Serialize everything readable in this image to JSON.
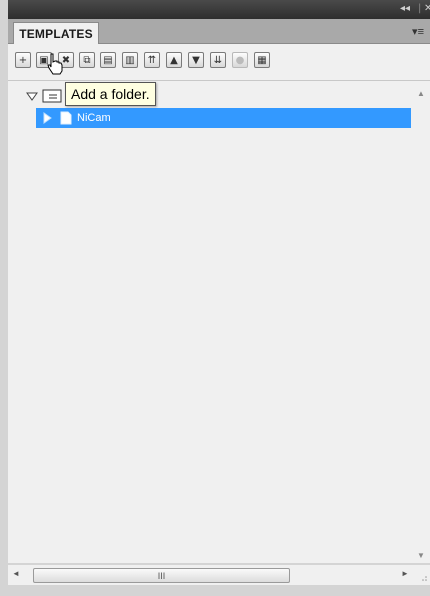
{
  "panel": {
    "tab_label": "TEMPLATES",
    "title_controls": {
      "collapse": "◂◂",
      "close": "✕"
    },
    "menu_icon": "▾≡"
  },
  "toolbar": {
    "buttons": [
      {
        "icon": "add-icon",
        "glyph": "+"
      },
      {
        "icon": "add-folder-icon",
        "glyph": "▣"
      },
      {
        "icon": "delete-icon",
        "glyph": "✖"
      },
      {
        "icon": "copy-icon",
        "glyph": "⧉"
      },
      {
        "icon": "import-icon",
        "glyph": "▤"
      },
      {
        "icon": "paste-icon",
        "glyph": "▥"
      },
      {
        "icon": "move-to-top-icon",
        "glyph": "⇈"
      },
      {
        "icon": "move-up-icon",
        "glyph": "▲"
      },
      {
        "icon": "move-down-icon",
        "glyph": "▼"
      },
      {
        "icon": "move-to-bottom-icon",
        "glyph": "⇊"
      },
      {
        "icon": "disabled-icon",
        "glyph": "●"
      },
      {
        "icon": "properties-icon",
        "glyph": "▦"
      }
    ]
  },
  "tooltip": {
    "text": "Add a folder."
  },
  "tree": {
    "child": {
      "label": "NiCam"
    }
  },
  "scrollbar": {
    "h_thumb_grip": "III",
    "left_arrow": "◄",
    "right_arrow": "►",
    "up_arrow": "▲",
    "down_arrow": "▼"
  },
  "colors": {
    "selection": "#3399ff",
    "tooltip_bg": "#ffffe1"
  }
}
